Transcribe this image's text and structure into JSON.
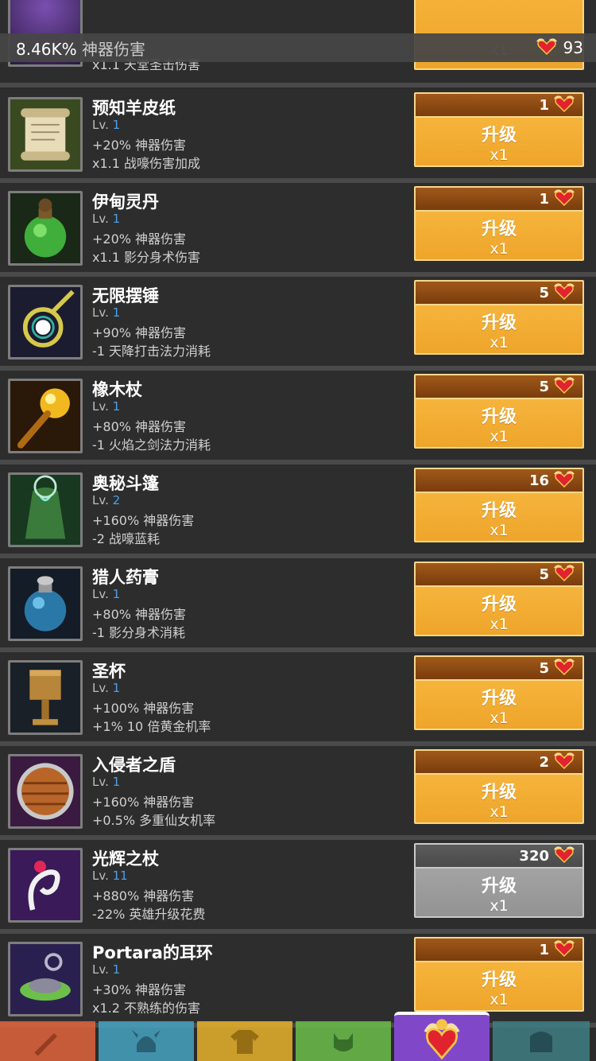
{
  "colors": {
    "upgrade_orange": "#f0a830",
    "upgrade_cost_brown": "#7a3d0c",
    "disabled_gray": "#8e8e8e",
    "level_blue": "#4f9ee6"
  },
  "status": {
    "damage_value": "8.46K%",
    "damage_label": "神器伤害",
    "currency_icon": "winged-heart-icon",
    "currency_amount": "93"
  },
  "top_buttons": [
    {
      "icon": "gear-icon"
    },
    {
      "icon": "crossed-swords-icon"
    },
    {
      "icon": "chevron-down-icon"
    },
    {
      "icon": "close-icon"
    }
  ],
  "partial_row": {
    "effect2": "x1.1 天堂圣击伤害",
    "multiplier": "x1"
  },
  "artifacts": [
    {
      "name": "预知羊皮纸",
      "lv_label": "Lv.",
      "lv": "1",
      "effect1": "+20% 神器伤害",
      "effect2": "x1.1 战嚎伤害加成",
      "cost": "1",
      "button_label": "升级",
      "multiplier": "x1",
      "enabled": true,
      "icon": "scroll-icon"
    },
    {
      "name": "伊甸灵丹",
      "lv_label": "Lv.",
      "lv": "1",
      "effect1": "+20% 神器伤害",
      "effect2": "x1.1 影分身术伤害",
      "cost": "1",
      "button_label": "升级",
      "multiplier": "x1",
      "enabled": true,
      "icon": "green-potion-icon"
    },
    {
      "name": "无限摆锤",
      "lv_label": "Lv.",
      "lv": "1",
      "effect1": "+90% 神器伤害",
      "effect2": "-1 天降打击法力消耗",
      "cost": "5",
      "button_label": "升级",
      "multiplier": "x1",
      "enabled": true,
      "icon": "pendulum-icon"
    },
    {
      "name": "橡木杖",
      "lv_label": "Lv.",
      "lv": "1",
      "effect1": "+80% 神器伤害",
      "effect2": "-1 火焰之剑法力消耗",
      "cost": "5",
      "button_label": "升级",
      "multiplier": "x1",
      "enabled": true,
      "icon": "staff-icon"
    },
    {
      "name": "奥秘斗篷",
      "lv_label": "Lv.",
      "lv": "2",
      "effect1": "+160% 神器伤害",
      "effect2": "-2 战嚎蓝耗",
      "cost": "16",
      "button_label": "升级",
      "multiplier": "x1",
      "enabled": true,
      "icon": "cloak-icon"
    },
    {
      "name": "猎人药膏",
      "lv_label": "Lv.",
      "lv": "1",
      "effect1": "+80% 神器伤害",
      "effect2": "-1 影分身术消耗",
      "cost": "5",
      "button_label": "升级",
      "multiplier": "x1",
      "enabled": true,
      "icon": "ointment-jar-icon"
    },
    {
      "name": "圣杯",
      "lv_label": "Lv.",
      "lv": "1",
      "effect1": "+100% 神器伤害",
      "effect2": "+1% 10 倍黄金机率",
      "cost": "5",
      "button_label": "升级",
      "multiplier": "x1",
      "enabled": true,
      "icon": "grail-icon"
    },
    {
      "name": "入侵者之盾",
      "lv_label": "Lv.",
      "lv": "1",
      "effect1": "+160% 神器伤害",
      "effect2": "+0.5% 多重仙女机率",
      "cost": "2",
      "button_label": "升级",
      "multiplier": "x1",
      "enabled": true,
      "icon": "shield-icon"
    },
    {
      "name": "光辉之杖",
      "lv_label": "Lv.",
      "lv": "11",
      "effect1": "+880% 神器伤害",
      "effect2": "-22% 英雄升级花费",
      "cost": "320",
      "button_label": "升级",
      "multiplier": "x1",
      "enabled": false,
      "icon": "radiant-staff-icon"
    },
    {
      "name": "Portara的耳环",
      "lv_label": "Lv.",
      "lv": "1",
      "effect1": "+30% 神器伤害",
      "effect2": "x1.2 不熟练的伤害",
      "cost": "1",
      "button_label": "升级",
      "multiplier": "x1",
      "enabled": true,
      "icon": "earring-icon"
    }
  ],
  "bottom_tabs": [
    {
      "icon": "sword-icon",
      "color": "#e0643c",
      "active": false
    },
    {
      "icon": "viking-helmet-icon",
      "color": "#47a3c2",
      "active": false
    },
    {
      "icon": "tunic-icon",
      "color": "#e8b32c",
      "active": false
    },
    {
      "icon": "pet-head-icon",
      "color": "#6cbe4a",
      "active": false
    },
    {
      "icon": "winged-heart-icon",
      "color": "#8048c8",
      "active": true
    },
    {
      "icon": "chest-icon",
      "color": "#3f7e84",
      "active": false
    }
  ]
}
